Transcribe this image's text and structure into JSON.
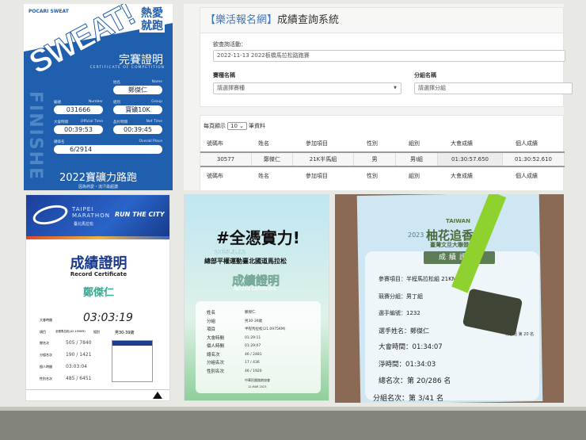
{
  "sweat_cert": {
    "logos": "POCARI SWEAT",
    "big_text": "SWEAT!",
    "slogan": [
      "熱愛",
      "就跑"
    ],
    "finish_text": "FINISHE",
    "title": "完賽證明",
    "subtitle": "CERTIFICATE OF COMPETITION",
    "fields": [
      {
        "label": "姓名",
        "label_en": "Name",
        "value": "鄭傑仁"
      },
      {
        "label": "編號",
        "label_en": "Number",
        "value": "031666"
      },
      {
        "label": "組別",
        "label_en": "Group",
        "value": "寶礦10K"
      },
      {
        "label": "大會時間",
        "label_en": "Official Time",
        "value": "00:39:53"
      },
      {
        "label": "晶片時間",
        "label_en": "Net Time",
        "value": "00:39:45"
      },
      {
        "label": "總排名",
        "label_en": "Overall Place",
        "value": "6/2914"
      }
    ],
    "event": "2022寶礦力路跑",
    "tagline": "因為熱愛・流汗最超讚"
  },
  "results_site": {
    "title_bracket": "【樂活報名網】",
    "title": "成績查詢系統",
    "event_label": "欲查詢活動：",
    "event_value": "2022-11-13 2022板橋馬拉松路跑賽",
    "race_label": "賽種名稱",
    "race_placeholder": "請選擇賽種",
    "group_label": "分組名稱",
    "group_placeholder": "請選擇分組",
    "per_page_prefix": "每頁顯示",
    "per_page": "10",
    "per_page_suffix": "筆資料",
    "columns": [
      "號碼布",
      "姓名",
      "參加項目",
      "性別",
      "組別",
      "大會成績",
      "個人成績"
    ],
    "rows": [
      [
        "30577",
        "鄭傑仁",
        "21K半馬組",
        "男",
        "男I組",
        "01:30:57.650",
        "01:30:52.610"
      ]
    ]
  },
  "taipei_cert": {
    "brand": "TAIPEI MARATHON",
    "brand_zh": "臺北馬拉松",
    "slogan": "RUN THE CITY",
    "title": "成績證明",
    "title_en": "Record Certificate",
    "name": "鄭傑仁",
    "official_time_label": "大會時間",
    "official_time": "03:03:19",
    "event_label": "項目",
    "event": "全程馬拉松(42.195KM)",
    "division_label": "組別",
    "division": "男30-39歲",
    "overall_label": "總名次",
    "overall": "505 / 7840",
    "division_place_label": "分組名次",
    "division_place": "190 / 1421",
    "net_time_label": "個人時間",
    "net_time": "03:03:04",
    "gender_place_label": "性別名次",
    "gender_place": "485 / 6451"
  },
  "equality_cert": {
    "headline": "#全憑實力!",
    "date": "2023.3.12",
    "event": "總部平權運動臺北國道馬拉松",
    "title": "成績證明",
    "title_en": "Record Certificate",
    "rows": [
      [
        "姓名",
        "鄭傑仁"
      ],
      [
        "分組",
        "男30-39歲"
      ],
      [
        "項目",
        "半程馬拉松(21.0975KM)"
      ],
      [
        "大會時間",
        "01:29:11"
      ],
      [
        "個人時間",
        "01:29:07"
      ],
      [
        "總名次",
        "46 / 2481"
      ],
      [
        "分組名次",
        "17 / 436"
      ],
      [
        "性別名次",
        "46 / 1920"
      ]
    ],
    "org": "中華民國路跑協會",
    "footer_date": "12.MAR 2023"
  },
  "photo_cert": {
    "brand": "TAIWAN",
    "year": "2023",
    "event": "柚花追香",
    "event_sub": "臺灣文旦大聯盟",
    "title": "成績證明",
    "rows": [
      [
        "參賽項目",
        "半程馬拉松組 21KM"
      ],
      [
        "競賽分組",
        "男丁組"
      ],
      [
        "選手編號",
        "1232"
      ],
      [
        "選手姓名",
        "鄭傑仁"
      ],
      [
        "大會時間",
        "01:34:07"
      ],
      [
        "淨時間",
        "01:34:03"
      ],
      [
        "總名次",
        "第 20/286 名"
      ],
      [
        "分組名次",
        "第 3/41 名"
      ]
    ],
    "side_note": "男子組 第 20 名"
  }
}
